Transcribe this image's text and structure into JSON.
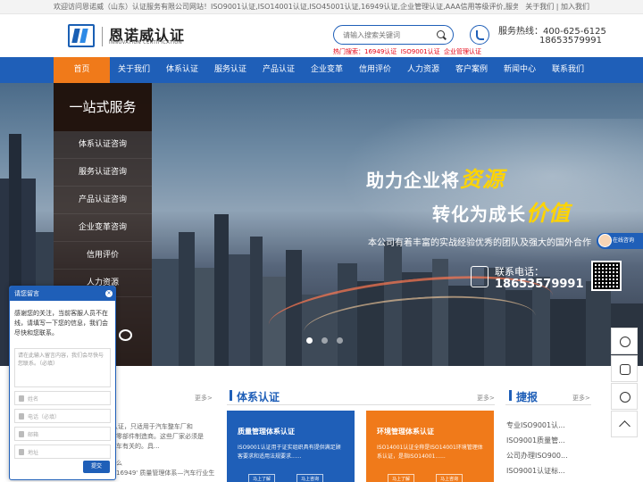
{
  "topbar": {
    "welcome": "欢迎访问恩诺威（山东）认证服务有限公司网站！ISO9001认证,ISO14001认证,ISO45001认证,16949认证,企业管理认证,AAA信用等级评价,服务认证,测量仪器校准",
    "links": "关于我们 | 加入我们"
  },
  "header": {
    "logo_cn": "恩诺威认证",
    "logo_en": "INNOVATION CERTIFICATION",
    "search_placeholder": "请输入搜索关键词",
    "hot_label": "热门搜索：",
    "hot_terms": [
      "16949认证",
      "ISO9001认证",
      "企业管理认证"
    ],
    "hotline_label": "服务热线：",
    "hotline": "400-625-6125",
    "mobile": "18653579991"
  },
  "nav": [
    "首页",
    "关于我们",
    "体系认证",
    "服务认证",
    "产品认证",
    "企业变革",
    "信用评价",
    "人力资源",
    "客户案例",
    "新闻中心",
    "联系我们"
  ],
  "side_menu": {
    "title": "一站式服务",
    "items": [
      "体系认证咨询",
      "服务认证咨询",
      "产品认证咨询",
      "企业变革咨询",
      "信用评价",
      "人力资源"
    ]
  },
  "banner": {
    "line1_prefix": "助力企业将",
    "line1_em": "资源",
    "line2_prefix": "转化为成长",
    "line2_em": "价值",
    "desc": "本公司有着丰富的实战经验优秀的团队及强大的国外合作",
    "contact_label": "联系电话：",
    "contact_tel": "18653579991",
    "online": "在线咨询"
  },
  "sections": {
    "left_more": "更多>",
    "left_frag1": "范围",
    "left_frag2": "49认证，只适用于汽车整车厂和",
    "left_frag3": "直接零部件制造商。这些厂家必须是",
    "left_frag4": "产汽车有关的。具...",
    "left_frag5": "么",
    "left_frag6": "16949' 质量管理体系—汽车行业生",
    "system": {
      "title": "体系认证",
      "more": "更多>",
      "cards": [
        {
          "title": "质量管理体系认证",
          "desc": "ISO9001认证用于证实组织具有提供满足顾客要求和适用法规要求......",
          "btn1": "马上了解",
          "btn2": "马上咨询"
        },
        {
          "title": "环境管理体系认证",
          "desc": "ISO14001认证全称是ISO14001环境管理体系认证，是指ISO14001......",
          "btn1": "马上了解",
          "btn2": "马上咨询"
        }
      ]
    },
    "news": {
      "title": "捷报",
      "more": "更多>",
      "items": [
        "专业ISO9001认...",
        "ISO9001质量管...",
        "公司办理ISO900...",
        "ISO9001认证标..."
      ]
    }
  },
  "chat": {
    "title": "请您留言",
    "close": "×",
    "message": "感谢您的关注，当前客服人员不在线，请填写一下您的信息，我们会尽快和您联系。",
    "textarea_placeholder": "请在此输入留言内容，我们会尽快与您联系。（必填）",
    "fields": [
      "姓名",
      "电话（必填）",
      "邮箱",
      "地址"
    ],
    "submit": "提交"
  }
}
